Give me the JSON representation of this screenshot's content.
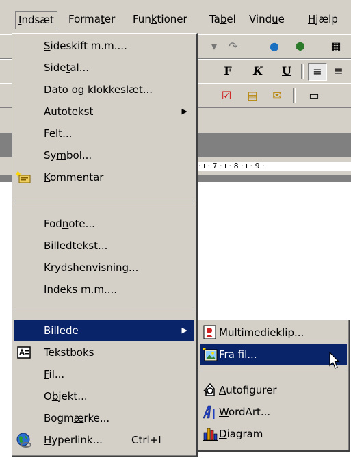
{
  "menubar": {
    "items": [
      {
        "pre": "",
        "u": "I",
        "post": "ndsæt"
      },
      {
        "pre": "Forma",
        "u": "t",
        "post": "er"
      },
      {
        "pre": "Fun",
        "u": "k",
        "post": "tioner"
      },
      {
        "pre": "Ta",
        "u": "b",
        "post": "el"
      },
      {
        "pre": "Vind",
        "u": "u",
        "post": "e"
      },
      {
        "pre": "",
        "u": "H",
        "post": "jælp"
      }
    ]
  },
  "toolbar": {
    "bold": "F",
    "italic": "K",
    "underline": "U"
  },
  "ruler": {
    "text": "· ı · 7 · ı · 8 · ı · 9 ·"
  },
  "insert_menu": {
    "items": [
      {
        "pre": "",
        "u": "S",
        "post": "ideskift m.m...."
      },
      {
        "pre": "Side",
        "u": "t",
        "post": "al..."
      },
      {
        "pre": "",
        "u": "D",
        "post": "ato og klokkeslæt..."
      },
      {
        "pre": "A",
        "u": "u",
        "post": "totekst"
      },
      {
        "pre": "F",
        "u": "e",
        "post": "lt..."
      },
      {
        "pre": "Sy",
        "u": "m",
        "post": "bol..."
      },
      {
        "pre": "",
        "u": "K",
        "post": "ommentar"
      },
      {
        "pre": "Fod",
        "u": "n",
        "post": "ote..."
      },
      {
        "pre": "Billed",
        "u": "t",
        "post": "ekst..."
      },
      {
        "pre": "Krydshen",
        "u": "v",
        "post": "isning..."
      },
      {
        "pre": "",
        "u": "I",
        "post": "ndeks m.m...."
      },
      {
        "pre": "Bi",
        "u": "l",
        "post": "lede"
      },
      {
        "pre": "Tekstb",
        "u": "o",
        "post": "ks"
      },
      {
        "pre": "",
        "u": "F",
        "post": "il..."
      },
      {
        "pre": "O",
        "u": "b",
        "post": "jekt..."
      },
      {
        "pre": "Bogm",
        "u": "æ",
        "post": "rke..."
      },
      {
        "pre": "",
        "u": "H",
        "post": "yperlink..."
      }
    ],
    "hyperlink_shortcut": "Ctrl+I"
  },
  "picture_submenu": {
    "items": [
      {
        "pre": "",
        "u": "M",
        "post": "ultimedieklip..."
      },
      {
        "pre": "",
        "u": "F",
        "post": "ra fil..."
      },
      {
        "pre": "",
        "u": "A",
        "post": "utofigurer"
      },
      {
        "pre": "",
        "u": "W",
        "post": "ordArt..."
      },
      {
        "pre": "",
        "u": "D",
        "post": "iagram"
      }
    ]
  },
  "colors": {
    "highlight": "#0a246a",
    "face": "#d4d0c8"
  }
}
